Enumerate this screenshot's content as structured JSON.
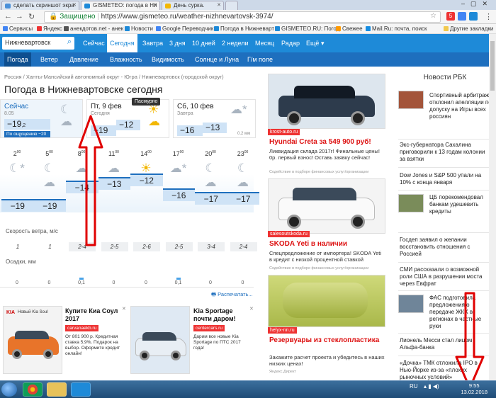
{
  "browser": {
    "tabs": [
      {
        "label": "сделать скриншот экра",
        "color": "#4a90d9"
      },
      {
        "label": "GISMETEO: погода в Ни",
        "color": "#1e8ad8"
      },
      {
        "label": "День сурка.",
        "color": "#f2b705"
      }
    ],
    "secure_label": "Защищено",
    "url": "https://www.gismeteo.ru/weather-nizhnevartovsk-3974/",
    "badge": "5",
    "bookmarks": [
      {
        "label": "Сервисы",
        "color": "#4285f4"
      },
      {
        "label": "Яндекс",
        "color": "#e33"
      },
      {
        "label": "анекдотов.net - анек",
        "color": "#555"
      },
      {
        "label": "Новости",
        "color": "#1e8ad8"
      },
      {
        "label": "Google Переводчик",
        "color": "#4285f4"
      },
      {
        "label": "Погода в Нижневарт",
        "color": "#1e8ad8"
      },
      {
        "label": "GISMETEO.RU: Погод",
        "color": "#1e8ad8"
      },
      {
        "label": "Свежее",
        "color": "#f90"
      },
      {
        "label": "Mail.Ru: почта, поиск",
        "color": "#168de2"
      },
      {
        "label": "Другие закладки",
        "color": "#f2c94c"
      }
    ]
  },
  "site": {
    "search_value": "Нижневартовск",
    "top_nav": [
      "Сейчас",
      "Сегодня",
      "Завтра",
      "3 дня",
      "10 дней",
      "2 недели",
      "Месяц",
      "Радар",
      "Ещё"
    ],
    "top_nav_active": "Сегодня",
    "sub_nav": [
      "Погода",
      "Ветер",
      "Давление",
      "Влажность",
      "Видимость",
      "Солнце и Луна",
      "Г/м поле"
    ],
    "sub_nav_active": "Погода"
  },
  "main": {
    "breadcrumb": "Россия  /  Ханты-Мансийский автономный округ - Югра  /  Нижневартовск (городской округ)",
    "title": "Погода в Нижневартовске сегодня",
    "now": {
      "label": "Сейчас",
      "time": "8.05",
      "temp": "−19",
      "temp_frac": ",2",
      "feels": "По ощущению −20"
    },
    "today": {
      "label": "Пт, 9 фев",
      "sub": "Сегодня",
      "t1": "−19",
      "t2": "−12",
      "tooltip": "Пасмурно"
    },
    "tomorrow": {
      "label": "Сб, 10 фев",
      "sub": "Завтра",
      "t1": "−16",
      "t2": "−13",
      "snow": "0.2 мм"
    },
    "hours": [
      "2",
      "5",
      "8",
      "11",
      "14",
      "17",
      "20",
      "23"
    ],
    "hours_sup": "00",
    "hour_icons": [
      "moon-snow",
      "moon-cloud",
      "cloud",
      "cloud",
      "sun-cloud",
      "cloud-snow",
      "moon-cloud",
      "moon-cloud"
    ],
    "temps": [
      "−19",
      "−19",
      "−14",
      "−13",
      "−12",
      "−16",
      "−17",
      "−17"
    ],
    "temp_values": [
      -19,
      -19,
      -14,
      -13,
      -12,
      -16,
      -17,
      -17
    ],
    "wind_label": "Скорость ветра, м/с",
    "wind": [
      "1",
      "1",
      "2-4",
      "2-5",
      "2-6",
      "2-5",
      "3-4",
      "2-4"
    ],
    "precip_label": "Осадки, мм",
    "precip": [
      "0",
      "0",
      "0,1",
      "0",
      "0",
      "0,1",
      "0",
      "0"
    ],
    "print_label": "Распечатать..."
  },
  "bottom_ads": [
    {
      "title": "Купите Киа Соул 2017",
      "tag": "carvanaekb.ru",
      "text": "От 801 900 р. Кредитная ставка 5,9%. Подарок на выбор. Оформите кредит онлайн!",
      "brand": "Новый Kia Soul"
    },
    {
      "title": "Kia Sportage почти даром!",
      "tag": "centercars.ru",
      "text": "Дарим все новые Kia Sportage по ПТС 2017 года!"
    }
  ],
  "middle_ads": [
    {
      "tag": "krost-auto.ru",
      "title": "Hyundai Creta за 549 900 руб!",
      "text": "Ликвидация склада 2017г! Финальные цены! 0р. первый взнос! Оставь заявку сейчас!",
      "note": "Содействие в подборе финансовых услуг/организации"
    },
    {
      "tag": "salesoutskoda.ru",
      "title": "SKODA Yeti в наличии",
      "text": "Спецпредложение от импортера! SKODA Yeti в кредит с низкой процентной ставкой",
      "note": "Содействие в подборе финансовых услуг/организации"
    },
    {
      "tag": "helyx-nn.ru",
      "title": "Резервуары из стеклопластика",
      "text": "Закажите расчет проекта и убедитесь в наших низких ценах!",
      "note": "Яндекс.Директ"
    }
  ],
  "news": {
    "header": "Новости РБК",
    "items": [
      "Спортивный арбитраж отклонил апелляции по допуску на Игры всех россиян",
      "Экс-губернатора Сахалина приговорили к 13 годам колонии за взятки",
      "Dow Jones и S&P 500 упали на 10% с конца января",
      "ЦБ порекомендовал банкам удешевить кредиты",
      "Госдеп заявил о желании восстановить отношения с Россией",
      "СМИ рассказали о возможной роли США в разрушении моста через Евфрат",
      "ФАС подготовила предложения о передаче ЖКХ в регионах в частные руки",
      "Лионель Месси стал лицом Альфа-банка",
      "«Дочка» ТМК отложила IPO в Нью-Йорке из-за «плохих рыночных условий»"
    ]
  },
  "taskbar": {
    "lang": "RU",
    "time": "9:55",
    "date": "13.02.2018"
  },
  "colors": {
    "brand_blue": "#1e8ad8",
    "nav_dark": "#1e6fbe",
    "temp_chip": "#cfe3f6",
    "ad_red": "#e33",
    "arrow_red": "#e00000"
  }
}
